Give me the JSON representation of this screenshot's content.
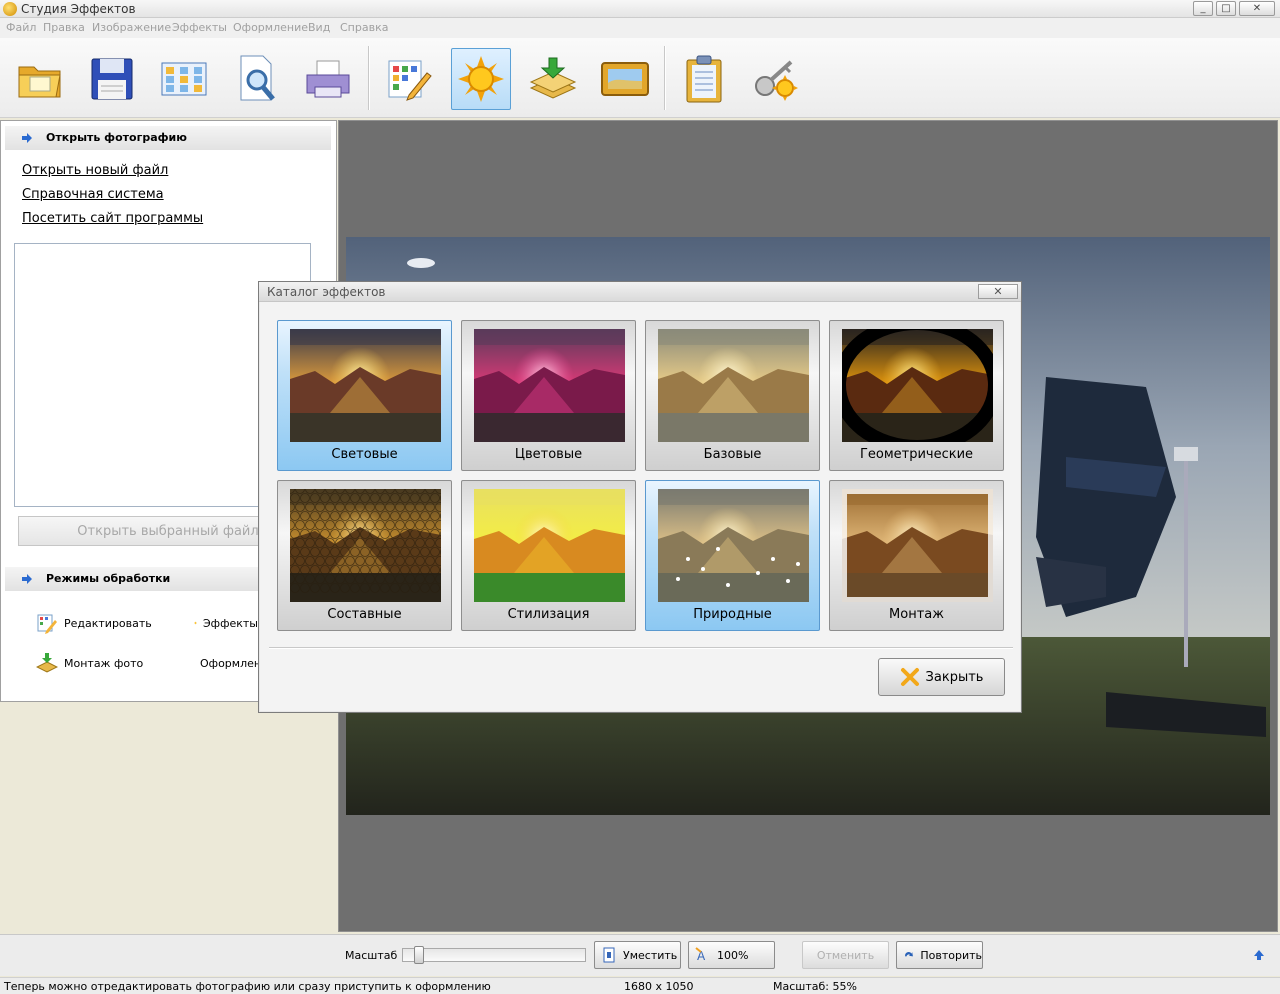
{
  "window": {
    "title": "Студия Эффектов",
    "controls": [
      "_",
      "□",
      "✕"
    ]
  },
  "menu": [
    "Файл",
    "Правка",
    "Изображение",
    "Эффекты",
    "Оформление",
    "Вид",
    "Справка"
  ],
  "toolbar": {
    "buttons": [
      {
        "name": "open-folder-button",
        "icon": "folder-icon"
      },
      {
        "name": "save-button",
        "icon": "floppy-icon"
      },
      {
        "name": "grid-button",
        "icon": "grid-icon"
      },
      {
        "name": "preview-button",
        "icon": "magnifier-icon"
      },
      {
        "name": "print-button",
        "icon": "printer-icon"
      },
      {
        "name": "edit-button",
        "icon": "pencil-grid-icon"
      },
      {
        "name": "effects-button",
        "icon": "sun-icon",
        "active": true
      },
      {
        "name": "montage-button",
        "icon": "layers-icon"
      },
      {
        "name": "frame-button",
        "icon": "picture-frame-icon"
      },
      {
        "name": "clipboard-button",
        "icon": "clipboard-icon"
      },
      {
        "name": "keys-button",
        "icon": "keys-icon"
      }
    ]
  },
  "left_panel": {
    "open_section": {
      "title": "Открыть фотографию",
      "links": [
        "Открыть новый файл",
        "Справочная система",
        "Посетить сайт программы"
      ],
      "open_selected_label": "Открыть выбранный файл"
    },
    "modes_section": {
      "title": "Режимы обработки",
      "items": [
        {
          "label": "Редактировать",
          "icon": "edit-icon"
        },
        {
          "label": "Эффекты",
          "icon": "sun-icon"
        },
        {
          "label": "Монтаж фото",
          "icon": "montage-icon"
        },
        {
          "label": "Оформление",
          "icon": "frame-icon"
        }
      ]
    }
  },
  "dialog": {
    "title": "Каталог эффектов",
    "close_x": "✕",
    "tiles": [
      {
        "label": "Световые",
        "selected": true,
        "style": "light"
      },
      {
        "label": "Цветовые",
        "selected": false,
        "style": "color"
      },
      {
        "label": "Базовые",
        "selected": false,
        "style": "basic"
      },
      {
        "label": "Геометрические",
        "selected": false,
        "style": "geometric"
      },
      {
        "label": "Составные",
        "selected": false,
        "style": "composite"
      },
      {
        "label": "Стилизация",
        "selected": false,
        "style": "stylize"
      },
      {
        "label": "Природные",
        "selected": true,
        "style": "nature"
      },
      {
        "label": "Монтаж",
        "selected": false,
        "style": "montage"
      }
    ],
    "close_label": "Закрыть"
  },
  "bottom_bar": {
    "zoom_label": "Масштаб",
    "zoom_slider_value": 0.06,
    "fit_label": "Уместить",
    "actual_label": "100%",
    "undo_label": "Отменить",
    "redo_label": "Повторить"
  },
  "status_bar": {
    "message": "Теперь можно отредактировать фотографию или сразу приступить к оформлению",
    "dimensions": "1680 x 1050",
    "zoom": "Масштаб: 55%"
  }
}
